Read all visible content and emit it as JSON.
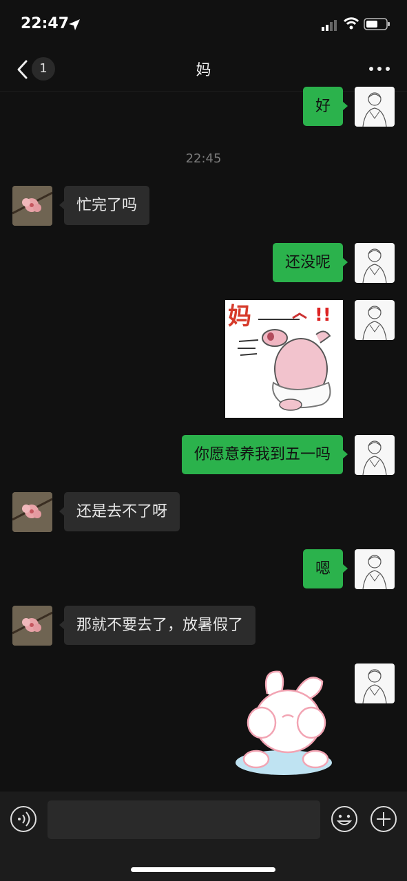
{
  "status_bar": {
    "time": "22:47",
    "icons": [
      "location-arrow-icon",
      "cellular-signal-icon",
      "wifi-icon",
      "battery-icon"
    ]
  },
  "nav": {
    "unread_count": "1",
    "title": "妈",
    "icons": [
      "back-chevron-icon",
      "more-dots-icon"
    ]
  },
  "messages": [
    {
      "from": "me",
      "text": "好"
    },
    {
      "type": "time",
      "text": "22:45"
    },
    {
      "from": "mom",
      "text": "忙完了吗"
    },
    {
      "from": "me",
      "text": "还没呢"
    },
    {
      "from": "me",
      "type": "sticker",
      "text": "妈"
    },
    {
      "from": "me",
      "text": "你愿意养我到五一吗"
    },
    {
      "from": "mom",
      "text": "还是去不了呀"
    },
    {
      "from": "me",
      "text": "嗯"
    },
    {
      "from": "mom",
      "text": "那就不要去了，放暑假了"
    },
    {
      "from": "me",
      "type": "sticker"
    }
  ],
  "bottom_bar": {
    "icons": [
      "voice-icon",
      "emoji-icon",
      "plus-icon"
    ],
    "input_value": ""
  },
  "colors": {
    "background": "#111111",
    "my_bubble": "#2bb24c",
    "their_bubble": "#2c2c2c",
    "bottom_bar": "#1c1c1c"
  }
}
